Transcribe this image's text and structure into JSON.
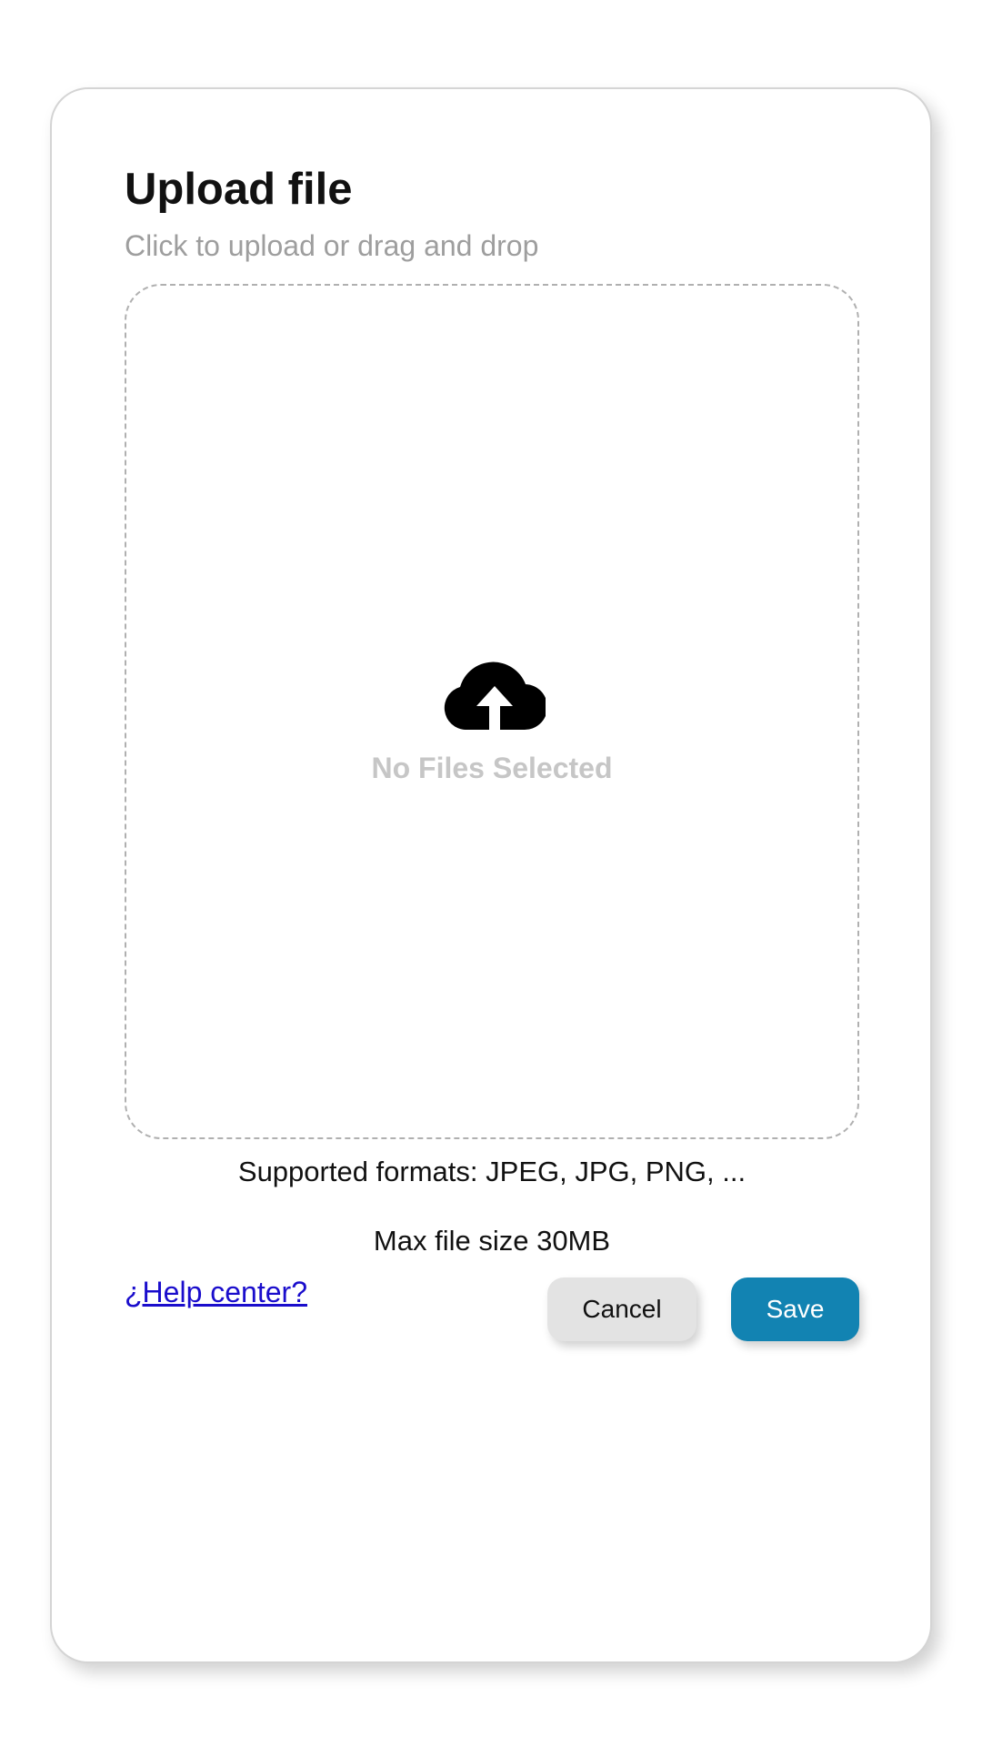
{
  "dialog": {
    "title": "Upload file",
    "subtitle": "Click to upload or drag and drop",
    "dropzone": {
      "icon": "cloud-upload-icon",
      "empty_label": "No Files Selected"
    },
    "supported_formats": "Supported formats: JPEG, JPG, PNG, ...",
    "max_size": "Max file size 30MB",
    "help_link": "¿Help center?",
    "cancel_label": "Cancel",
    "save_label": "Save"
  },
  "colors": {
    "accent": "#1283b2",
    "link": "#1a0dcc",
    "cancel_bg": "#e3e3e3"
  }
}
